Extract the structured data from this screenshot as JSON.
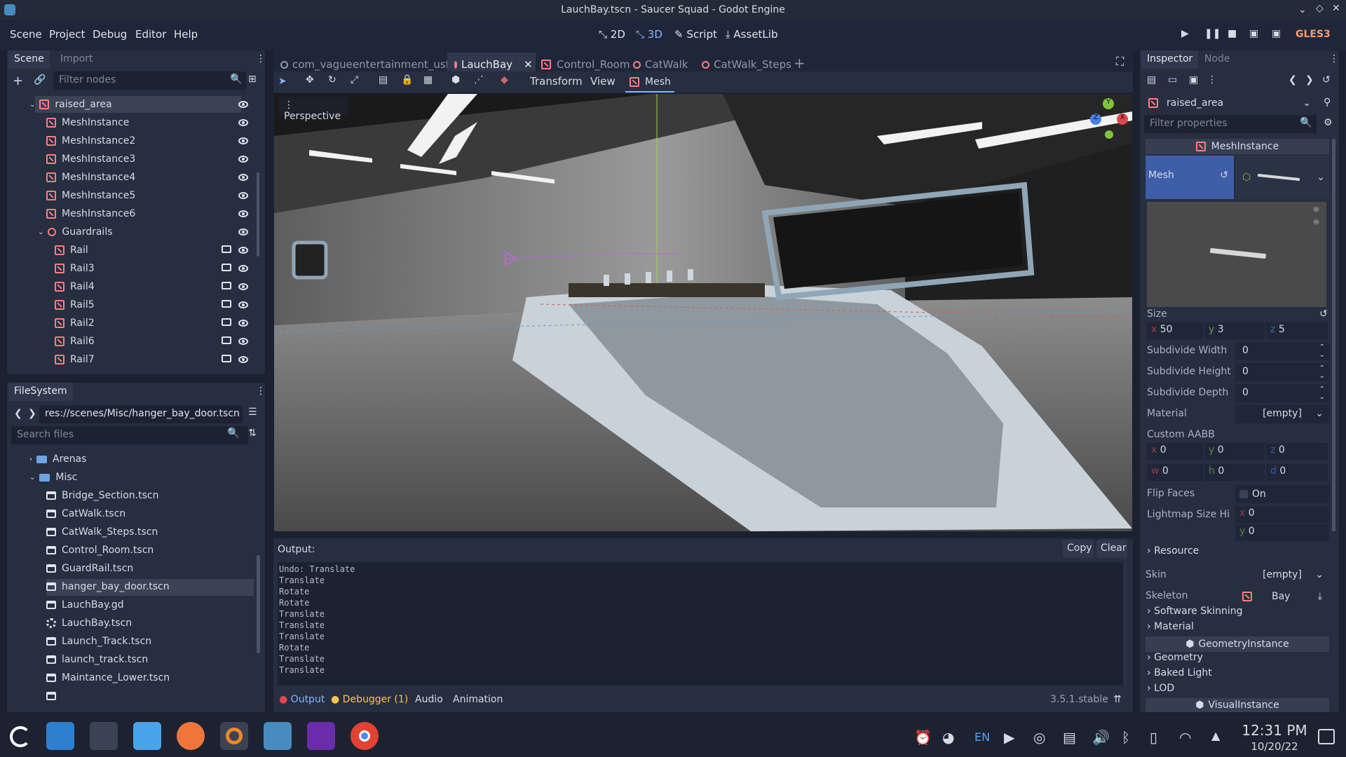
{
  "window": {
    "title": "LauchBay.tscn - Saucer Squad - Godot Engine"
  },
  "menu": [
    "Scene",
    "Project",
    "Debug",
    "Editor",
    "Help"
  ],
  "modes": {
    "m2d": "2D",
    "m3d": "3D",
    "script": "Script",
    "assetlib": "AssetLib"
  },
  "renderer": "GLES3",
  "scene_dock": {
    "tab_scene": "Scene",
    "tab_import": "Import",
    "filter_placeholder": "Filter nodes",
    "nodes": [
      "raised_area",
      "MeshInstance",
      "MeshInstance2",
      "MeshInstance3",
      "MeshInstance4",
      "MeshInstance5",
      "MeshInstance6",
      "Guardrails",
      "Rail",
      "Rail3",
      "Rail4",
      "Rail5",
      "Rail2",
      "Rail6",
      "Rail7"
    ]
  },
  "filesystem": {
    "tab": "FileSystem",
    "path": "res://scenes/Misc/hanger_bay_door.tscn",
    "search_placeholder": "Search files",
    "items": [
      "Arenas",
      "Misc",
      "Bridge_Section.tscn",
      "CatWalk.tscn",
      "CatWalk_Steps.tscn",
      "Control_Room.tscn",
      "GuardRail.tscn",
      "hanger_bay_door.tscn",
      "LauchBay.gd",
      "LauchBay.tscn",
      "Launch_Track.tscn",
      "launch_track.tscn",
      "Maintance_Lower.tscn"
    ]
  },
  "tabs": [
    "com_vagueentertainment_usfg",
    "LauchBay",
    "Control_Room",
    "CatWalk",
    "CatWalk_Steps"
  ],
  "toolbar": {
    "transform": "Transform",
    "view": "View",
    "mesh": "Mesh"
  },
  "viewport": {
    "perspective": "Perspective",
    "gizmo_x": "X",
    "gizmo_y": "Y",
    "gizmo_z": "Z"
  },
  "output": {
    "label": "Output:",
    "copy": "Copy",
    "clear": "Clear",
    "lines": [
      "Undo: Translate",
      "Translate",
      "Rotate",
      "Rotate",
      "Translate",
      "Translate",
      "Translate",
      "Rotate",
      "Translate",
      "Translate"
    ]
  },
  "bottom_tabs": {
    "output": "Output",
    "debugger": "Debugger (1)",
    "audio": "Audio",
    "animation": "Animation",
    "version": "3.5.1.stable"
  },
  "inspector": {
    "tab": "Inspector",
    "tab_node": "Node",
    "object": "raised_area",
    "filter_placeholder": "Filter properties",
    "section_mesh": "MeshInstance",
    "mesh_label": "Mesh",
    "size_label": "Size",
    "size": {
      "x": "50",
      "y": "3",
      "z": "5"
    },
    "subdiv_w_label": "Subdivide Width",
    "subdiv_w": "0",
    "subdiv_h_label": "Subdivide Height",
    "subdiv_h": "0",
    "subdiv_d_label": "Subdivide Depth",
    "subdiv_d": "0",
    "material_label": "Material",
    "material": "[empty]",
    "aabb_label": "Custom AABB",
    "aabb": {
      "x": "0",
      "y": "0",
      "z": "0",
      "w": "0",
      "h": "0",
      "d": "0"
    },
    "flip_label": "Flip Faces",
    "flip": "On",
    "lightmap_label": "Lightmap Size Hi",
    "lightmap": {
      "x": "0",
      "y": "0"
    },
    "resource": "Resource",
    "skin_label": "Skin",
    "skin": "[empty]",
    "skeleton_label": "Skeleton",
    "skeleton": "Bay",
    "software_skinning": "Software Skinning",
    "material_section": "Material",
    "geometry_instance": "GeometryInstance",
    "geometry": "Geometry",
    "baked_light": "Baked Light",
    "lod": "LOD",
    "visual_instance": "VisualInstance"
  },
  "taskbar": {
    "lang": "EN",
    "time": "12:31 PM",
    "date": "10/20/22"
  }
}
